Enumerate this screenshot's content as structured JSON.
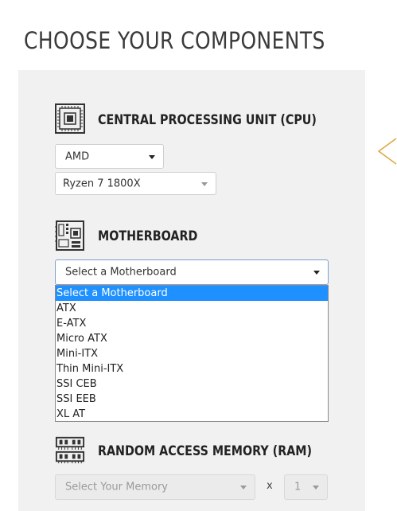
{
  "page_title": "CHOOSE YOUR COMPONENTS",
  "cpu": {
    "title": "CENTRAL PROCESSING UNIT (CPU)",
    "brand_value": "AMD",
    "model_value": "Ryzen 7 1800X"
  },
  "motherboard": {
    "title": "MOTHERBOARD",
    "select_value": "Select a Motherboard",
    "options": [
      "Select a Motherboard",
      "ATX",
      "E-ATX",
      "Micro ATX",
      "Mini-ITX",
      "Thin Mini-ITX",
      "SSI CEB",
      "SSI EEB",
      "XL AT"
    ],
    "selected_option": "Select a Motherboard"
  },
  "ram": {
    "title": "RANDOM ACCESS MEMORY (RAM)",
    "memory_placeholder": "Select Your Memory",
    "multiplier_label": "x",
    "quantity_value": "1"
  },
  "colors": {
    "panel": "#f1f1f1",
    "highlight": "#1e90ff",
    "accent_arrow": "#e0a640"
  },
  "icons": {
    "cpu": "cpu-chip-icon",
    "motherboard": "motherboard-icon",
    "ram": "ram-memory-icon",
    "side": "chevron-left-icon"
  }
}
